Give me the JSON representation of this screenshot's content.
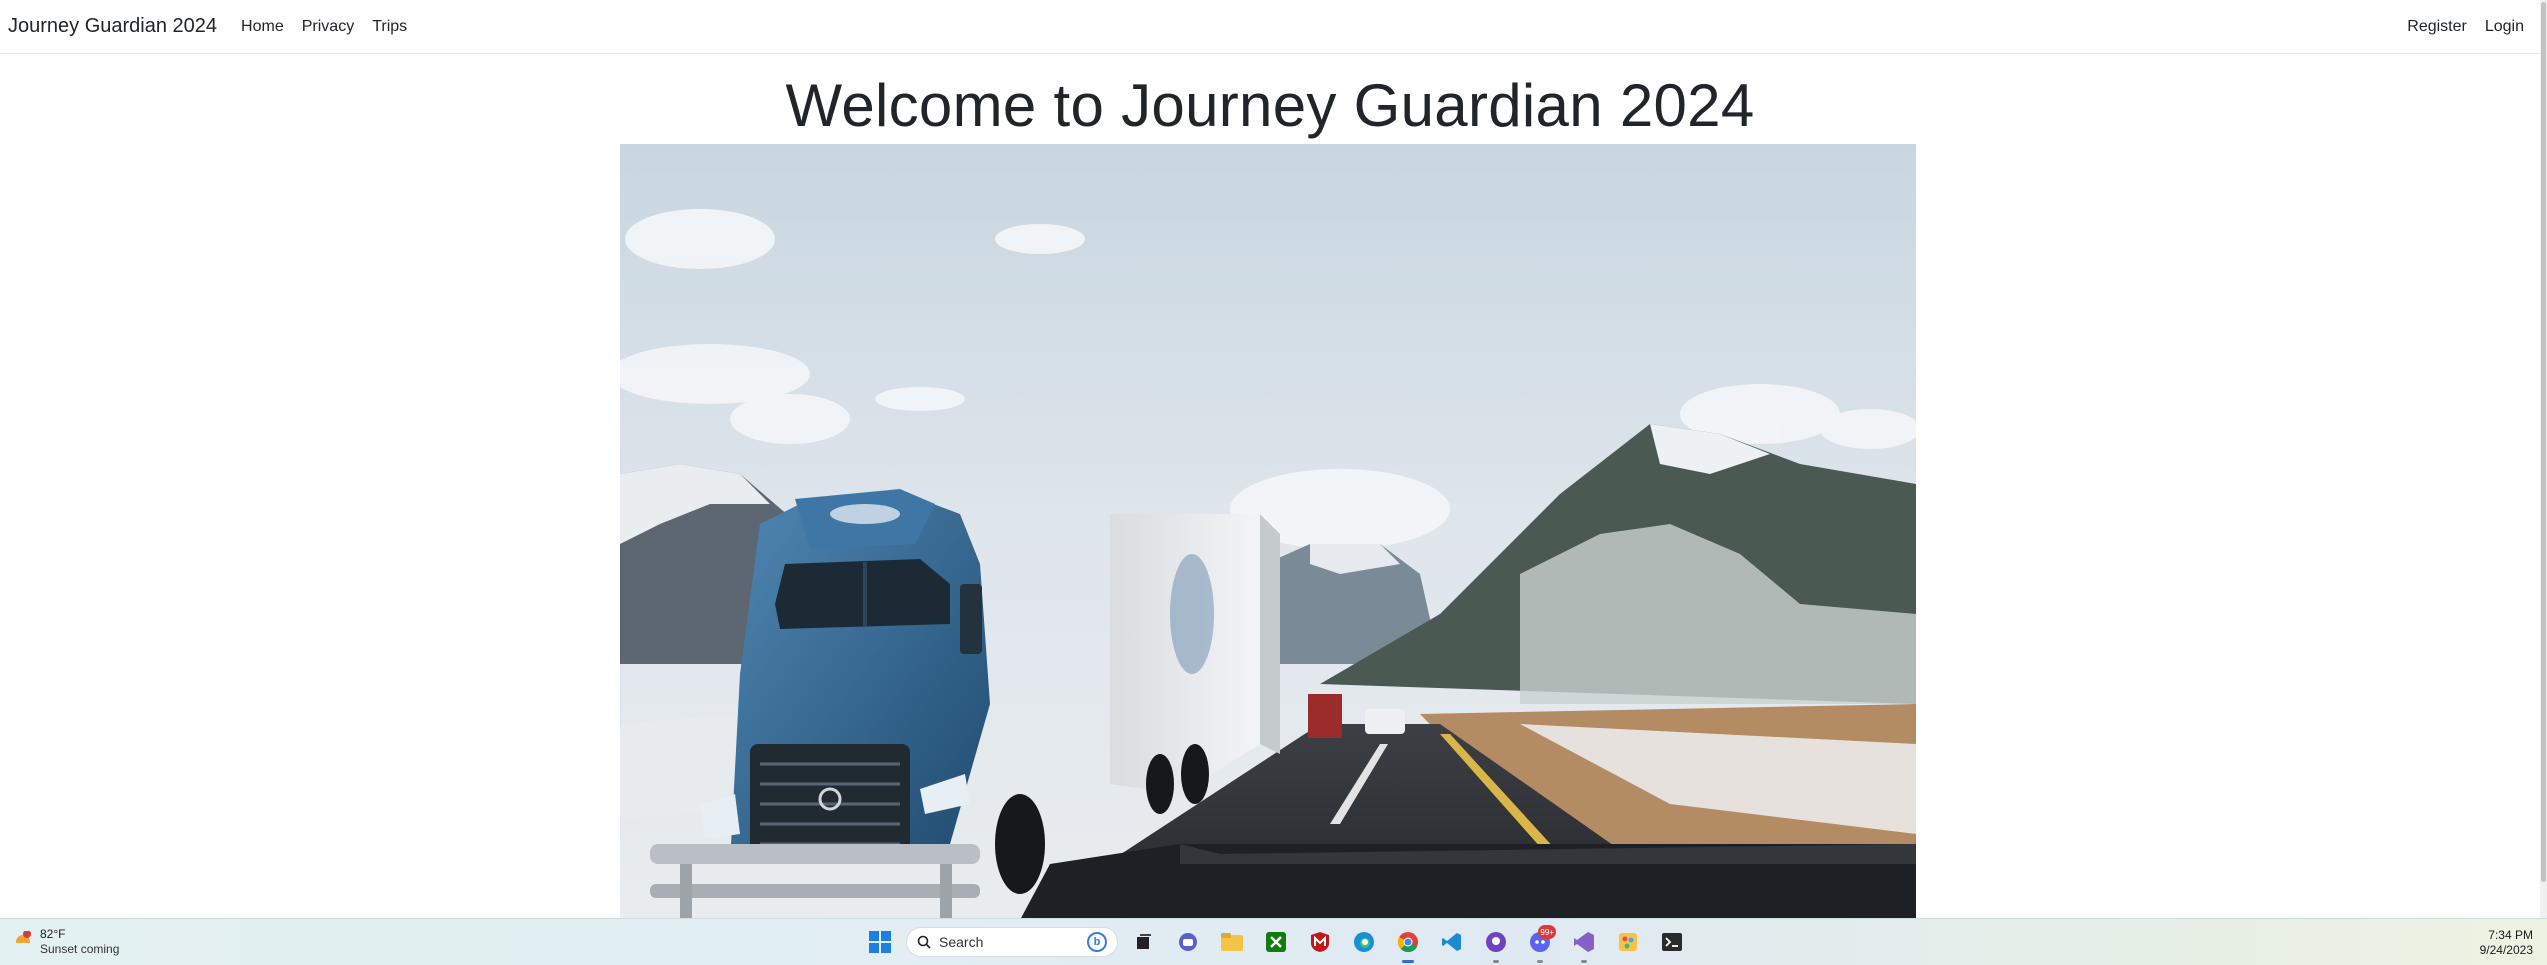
{
  "navbar": {
    "brand": "Journey Guardian 2024",
    "links": [
      "Home",
      "Privacy",
      "Trips"
    ],
    "right_links": [
      "Register",
      "Login"
    ]
  },
  "main": {
    "heading": "Welcome to Journey Guardian 2024",
    "hero_image": {
      "description_icon": "photo-truck-mountain-highway"
    }
  },
  "taskbar": {
    "weather": {
      "temp": "82°F",
      "condition": "Sunset coming",
      "alert_count": "1"
    },
    "search_placeholder": "Search",
    "apps": [
      {
        "name": "task-view-icon"
      },
      {
        "name": "teams-chat-icon"
      },
      {
        "name": "file-explorer-icon"
      },
      {
        "name": "xbox-icon"
      },
      {
        "name": "mcafee-icon"
      },
      {
        "name": "edge-icon"
      },
      {
        "name": "chrome-icon"
      },
      {
        "name": "vscode-icon"
      },
      {
        "name": "github-desktop-icon"
      },
      {
        "name": "discord-icon",
        "badge": "99+"
      },
      {
        "name": "visual-studio-icon"
      },
      {
        "name": "paint-icon"
      },
      {
        "name": "terminal-icon"
      }
    ],
    "clock": {
      "time": "7:34 PM",
      "date": "9/24/2023"
    }
  },
  "colors": {
    "text": "#212529",
    "nav_border": "#e5e5e5",
    "windows_blue": "#0078d4",
    "chrome_indicator": "#2d6fd1"
  }
}
